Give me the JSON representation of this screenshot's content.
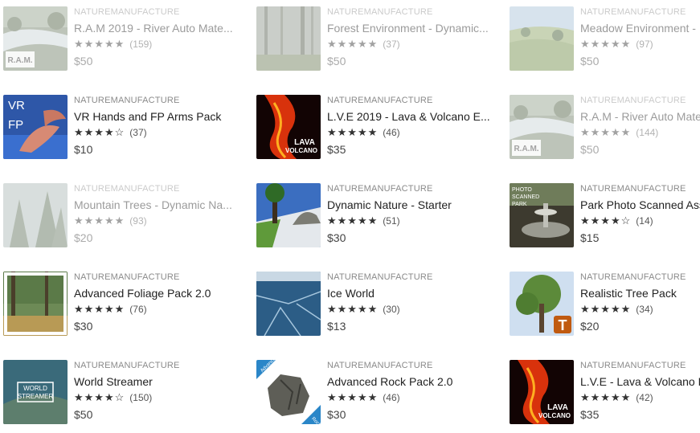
{
  "cards": [
    {
      "publisher": "NATUREMANUFACTURE",
      "title": "R.A.M 2019 - River Auto Mate...",
      "stars": "★★★★★",
      "count": "(159)",
      "price": "$50",
      "thumb": "ram-river-thumbnail",
      "faded": true,
      "thumb_text": "R.A.M."
    },
    {
      "publisher": "NATUREMANUFACTURE",
      "title": "Forest Environment - Dynamic...",
      "stars": "★★★★★",
      "count": "(37)",
      "price": "$50",
      "thumb": "forest-thumbnail",
      "faded": true,
      "thumb_text": ""
    },
    {
      "publisher": "NATUREMANUFACTURE",
      "title": "Meadow Environment - D",
      "stars": "★★★★★",
      "count": "(97)",
      "price": "$50",
      "thumb": "meadow-thumbnail",
      "faded": true,
      "thumb_text": ""
    },
    {
      "publisher": "NATUREMANUFACTURE",
      "title": "VR Hands and FP Arms Pack",
      "stars": "★★★★☆",
      "count": "(37)",
      "price": "$10",
      "thumb": "vr-hands-thumbnail",
      "faded": false,
      "thumb_text": "VR FP"
    },
    {
      "publisher": "NATUREMANUFACTURE",
      "title": "L.V.E 2019 - Lava & Volcano E...",
      "stars": "★★★★★",
      "count": "(46)",
      "price": "$35",
      "thumb": "lava-thumbnail",
      "faded": false,
      "thumb_text": "LAVA VOLCANO"
    },
    {
      "publisher": "NATUREMANUFACTURE",
      "title": "R.A.M - River Auto Mater",
      "stars": "★★★★★",
      "count": "(144)",
      "price": "$50",
      "thumb": "ram-river-thumbnail",
      "faded": true,
      "thumb_text": "R.A.M."
    },
    {
      "publisher": "NATUREMANUFACTURE",
      "title": "Mountain Trees - Dynamic Na...",
      "stars": "★★★★★",
      "count": "(93)",
      "price": "$20",
      "thumb": "mountain-trees-thumbnail",
      "faded": true,
      "thumb_text": ""
    },
    {
      "publisher": "NATUREMANUFACTURE",
      "title": "Dynamic Nature - Starter",
      "stars": "★★★★★",
      "count": "(51)",
      "price": "$30",
      "thumb": "dynamic-nature-thumbnail",
      "faded": false,
      "thumb_text": ""
    },
    {
      "publisher": "NATUREMANUFACTURE",
      "title": "Park Photo Scanned Ass",
      "stars": "★★★★☆",
      "count": "(14)",
      "price": "$15",
      "thumb": "park-fountain-thumbnail",
      "faded": false,
      "thumb_text": "PHOTO SCANNED PARK"
    },
    {
      "publisher": "NATUREMANUFACTURE",
      "title": "Advanced Foliage Pack 2.0",
      "stars": "★★★★★",
      "count": "(76)",
      "price": "$30",
      "thumb": "foliage-thumbnail",
      "faded": false,
      "thumb_text": ""
    },
    {
      "publisher": "NATUREMANUFACTURE",
      "title": "Ice World",
      "stars": "★★★★★",
      "count": "(30)",
      "price": "$13",
      "thumb": "ice-thumbnail",
      "faded": false,
      "thumb_text": ""
    },
    {
      "publisher": "NATUREMANUFACTURE",
      "title": "Realistic Tree Pack",
      "stars": "★★★★★",
      "count": "(34)",
      "price": "$20",
      "thumb": "tree-thumbnail",
      "faded": false,
      "thumb_text": "T"
    },
    {
      "publisher": "NATUREMANUFACTURE",
      "title": "World Streamer",
      "stars": "★★★★☆",
      "count": "(150)",
      "price": "$50",
      "thumb": "world-streamer-thumbnail",
      "faded": false,
      "thumb_text": "WORLD STREAMER"
    },
    {
      "publisher": "NATUREMANUFACTURE",
      "title": "Advanced Rock Pack 2.0",
      "stars": "★★★★★",
      "count": "(46)",
      "price": "$30",
      "thumb": "rock-thumbnail",
      "faded": false,
      "thumb_text": "Advanced Rock Pack"
    },
    {
      "publisher": "NATUREMANUFACTURE",
      "title": "L.V.E - Lava & Volcano E",
      "stars": "★★★★★",
      "count": "(42)",
      "price": "$35",
      "thumb": "lava-thumbnail",
      "faded": false,
      "thumb_text": "LAVA VOLCANO"
    }
  ]
}
